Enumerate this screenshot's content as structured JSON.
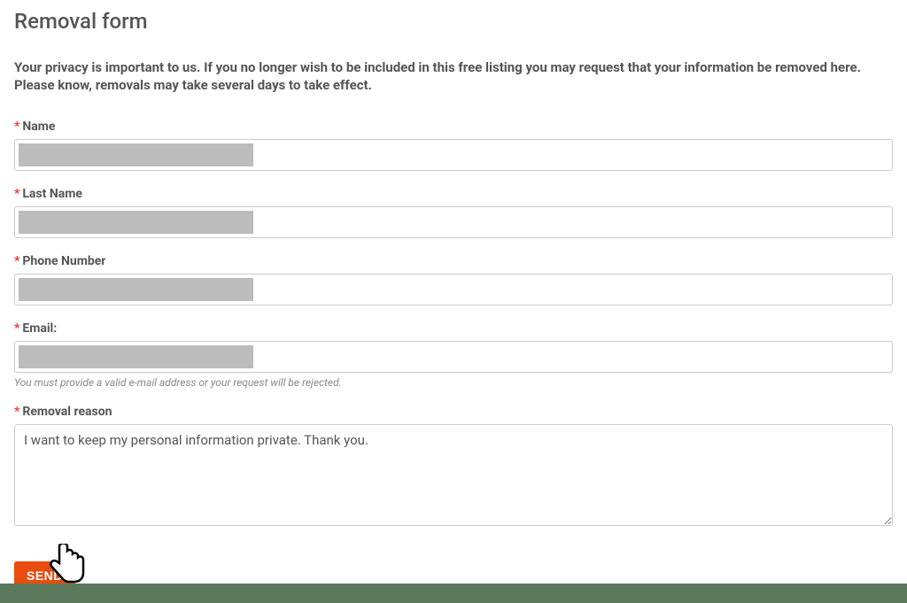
{
  "page": {
    "title": "Removal form",
    "intro": "Your privacy is important to us. If you no longer wish to be included in this free listing you may request that your information be removed here. Please know, removals may take several days to take effect."
  },
  "fields": {
    "name": {
      "label": "Name",
      "value": ""
    },
    "lastName": {
      "label": "Last Name",
      "value": ""
    },
    "phone": {
      "label": "Phone Number",
      "value": ""
    },
    "email": {
      "label": "Email:",
      "value": "",
      "hint": "You must provide a valid e-mail address or your request will be rejected."
    },
    "reason": {
      "label": "Removal reason",
      "value": "I want to keep my personal information private. Thank you."
    }
  },
  "buttons": {
    "send": "SEND"
  }
}
